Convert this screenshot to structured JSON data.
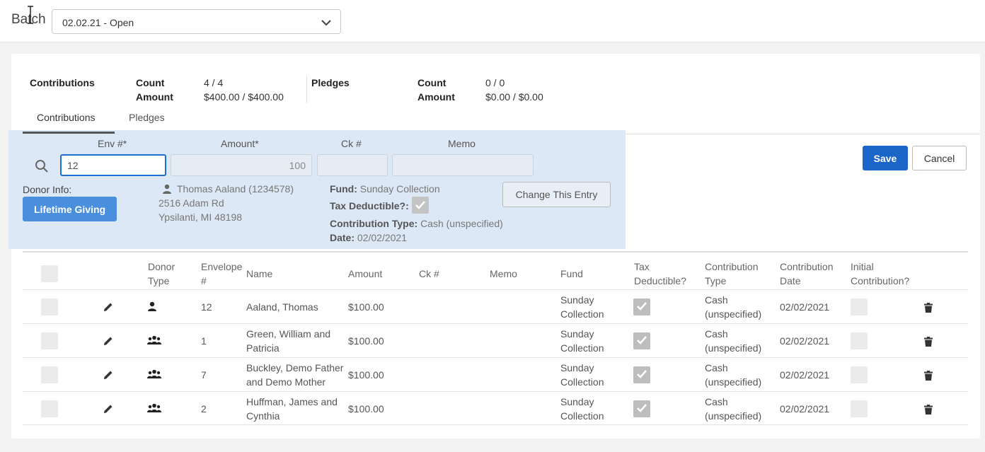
{
  "header": {
    "batch_label": "Batch",
    "batch_value": "02.02.21 - Open"
  },
  "summary": {
    "contributions_label": "Contributions",
    "contrib_count_label": "Count",
    "contrib_count": "4 / 4",
    "contrib_amount_label": "Amount",
    "contrib_amount": "$400.00 / $400.00",
    "pledges_label": "Pledges",
    "pledge_count_label": "Count",
    "pledge_count": "0 / 0",
    "pledge_amount_label": "Amount",
    "pledge_amount": "$0.00 / $0.00"
  },
  "tabs": [
    {
      "label": "Contributions",
      "active": true
    },
    {
      "label": "Pledges",
      "active": false
    }
  ],
  "entry": {
    "env_label": "Env #*",
    "env_value": "12",
    "amount_label": "Amount*",
    "amount_value": "100",
    "ck_label": "Ck #",
    "ck_value": "",
    "memo_label": "Memo",
    "memo_value": "",
    "donor_info_label": "Donor Info:",
    "lifetime_giving": "Lifetime Giving",
    "donor_name": "Thomas Aaland (1234578)",
    "donor_address1": "2516 Adam Rd",
    "donor_address2": "Ypsilanti, MI 48198",
    "fund_label": "Fund:",
    "fund_value": "Sunday Collection",
    "tax_label": "Tax Deductible?:",
    "ctype_label": "Contribution Type:",
    "ctype_value": "Cash (unspecified)",
    "date_label": "Date:",
    "date_value": "02/02/2021",
    "change_button": "Change This Entry"
  },
  "actions": {
    "save": "Save",
    "cancel": "Cancel"
  },
  "table": {
    "headers": {
      "donor_type": [
        "Donor",
        "Type"
      ],
      "envelope": [
        "Envelope",
        "#"
      ],
      "name": "Name",
      "amount": "Amount",
      "ck": "Ck #",
      "memo": "Memo",
      "fund": "Fund",
      "tax": [
        "Tax",
        "Deductible?"
      ],
      "ctype": [
        "Contribution",
        "Type"
      ],
      "cdate": [
        "Contribution",
        "Date"
      ],
      "initial": [
        "Initial",
        "Contribution?"
      ]
    },
    "rows": [
      {
        "donor_type": "person-icon",
        "envelope": "12",
        "name": [
          "Aaland, Thomas",
          ""
        ],
        "amount": "$100.00",
        "fund": [
          "Sunday",
          "Collection"
        ],
        "ctype": [
          "Cash",
          "(unspecified)"
        ],
        "date": "02/02/2021"
      },
      {
        "donor_type": "family-icon",
        "envelope": "1",
        "name": [
          "Green, William and",
          "Patricia"
        ],
        "amount": "$100.00",
        "fund": [
          "Sunday",
          "Collection"
        ],
        "ctype": [
          "Cash",
          "(unspecified)"
        ],
        "date": "02/02/2021"
      },
      {
        "donor_type": "family-icon",
        "envelope": "7",
        "name": [
          "Buckley, Demo Father",
          "and Demo Mother"
        ],
        "amount": "$100.00",
        "fund": [
          "Sunday",
          "Collection"
        ],
        "ctype": [
          "Cash",
          "(unspecified)"
        ],
        "date": "02/02/2021"
      },
      {
        "donor_type": "family-icon",
        "envelope": "2",
        "name": [
          "Huffman, James and",
          "Cynthia"
        ],
        "amount": "$100.00",
        "fund": [
          "Sunday",
          "Collection"
        ],
        "ctype": [
          "Cash",
          "(unspecified)"
        ],
        "date": "02/02/2021"
      }
    ]
  }
}
